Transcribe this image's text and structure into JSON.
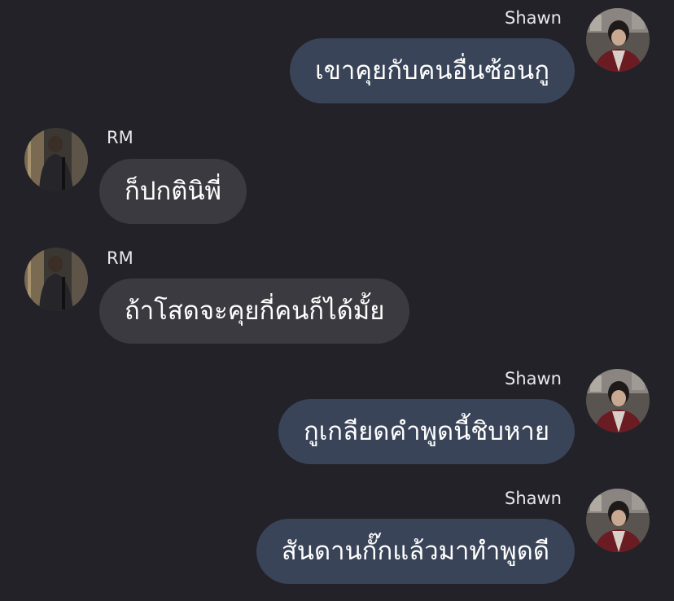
{
  "messages": [
    {
      "sender": "Shawn",
      "text": "เขาคุยกับคนอื่นซ้อนกู",
      "avatar": "shawn-avatar-photo",
      "direction": "outgoing"
    },
    {
      "sender": "RM",
      "text": "ก็ปกตินิพี่",
      "avatar": "rm-avatar-photo",
      "direction": "incoming"
    },
    {
      "sender": "RM",
      "text": "ถ้าโสดจะคุยกี่คนก็ได้มั้ย",
      "avatar": "rm-avatar-photo",
      "direction": "incoming"
    },
    {
      "sender": "Shawn",
      "text": "กูเกลียดคำพูดนี้ชิบหาย",
      "avatar": "shawn-avatar-photo",
      "direction": "outgoing"
    },
    {
      "sender": "Shawn",
      "text": "สันดานกั๊กแล้วมาทำพูดดี",
      "avatar": "shawn-avatar-photo",
      "direction": "outgoing"
    }
  ],
  "colors": {
    "background": "#222228",
    "outgoing_bubble": "#3a4458",
    "incoming_bubble": "#3a3a40",
    "text": "#ffffff"
  }
}
